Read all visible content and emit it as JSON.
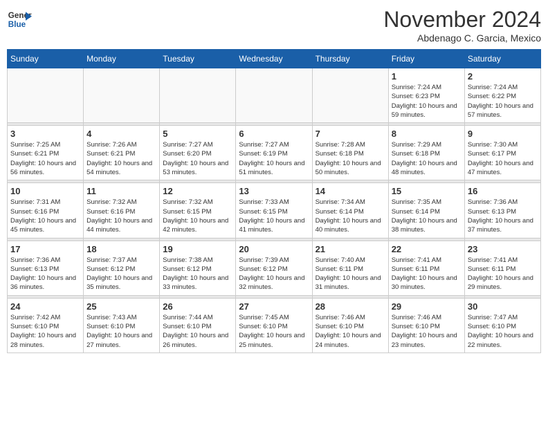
{
  "header": {
    "logo_line1": "General",
    "logo_line2": "Blue",
    "month": "November 2024",
    "location": "Abdenago C. Garcia, Mexico"
  },
  "days_of_week": [
    "Sunday",
    "Monday",
    "Tuesday",
    "Wednesday",
    "Thursday",
    "Friday",
    "Saturday"
  ],
  "weeks": [
    [
      {
        "day": "",
        "info": ""
      },
      {
        "day": "",
        "info": ""
      },
      {
        "day": "",
        "info": ""
      },
      {
        "day": "",
        "info": ""
      },
      {
        "day": "",
        "info": ""
      },
      {
        "day": "1",
        "info": "Sunrise: 7:24 AM\nSunset: 6:23 PM\nDaylight: 10 hours\nand 59 minutes."
      },
      {
        "day": "2",
        "info": "Sunrise: 7:24 AM\nSunset: 6:22 PM\nDaylight: 10 hours\nand 57 minutes."
      }
    ],
    [
      {
        "day": "3",
        "info": "Sunrise: 7:25 AM\nSunset: 6:21 PM\nDaylight: 10 hours\nand 56 minutes."
      },
      {
        "day": "4",
        "info": "Sunrise: 7:26 AM\nSunset: 6:21 PM\nDaylight: 10 hours\nand 54 minutes."
      },
      {
        "day": "5",
        "info": "Sunrise: 7:27 AM\nSunset: 6:20 PM\nDaylight: 10 hours\nand 53 minutes."
      },
      {
        "day": "6",
        "info": "Sunrise: 7:27 AM\nSunset: 6:19 PM\nDaylight: 10 hours\nand 51 minutes."
      },
      {
        "day": "7",
        "info": "Sunrise: 7:28 AM\nSunset: 6:18 PM\nDaylight: 10 hours\nand 50 minutes."
      },
      {
        "day": "8",
        "info": "Sunrise: 7:29 AM\nSunset: 6:18 PM\nDaylight: 10 hours\nand 48 minutes."
      },
      {
        "day": "9",
        "info": "Sunrise: 7:30 AM\nSunset: 6:17 PM\nDaylight: 10 hours\nand 47 minutes."
      }
    ],
    [
      {
        "day": "10",
        "info": "Sunrise: 7:31 AM\nSunset: 6:16 PM\nDaylight: 10 hours\nand 45 minutes."
      },
      {
        "day": "11",
        "info": "Sunrise: 7:32 AM\nSunset: 6:16 PM\nDaylight: 10 hours\nand 44 minutes."
      },
      {
        "day": "12",
        "info": "Sunrise: 7:32 AM\nSunset: 6:15 PM\nDaylight: 10 hours\nand 42 minutes."
      },
      {
        "day": "13",
        "info": "Sunrise: 7:33 AM\nSunset: 6:15 PM\nDaylight: 10 hours\nand 41 minutes."
      },
      {
        "day": "14",
        "info": "Sunrise: 7:34 AM\nSunset: 6:14 PM\nDaylight: 10 hours\nand 40 minutes."
      },
      {
        "day": "15",
        "info": "Sunrise: 7:35 AM\nSunset: 6:14 PM\nDaylight: 10 hours\nand 38 minutes."
      },
      {
        "day": "16",
        "info": "Sunrise: 7:36 AM\nSunset: 6:13 PM\nDaylight: 10 hours\nand 37 minutes."
      }
    ],
    [
      {
        "day": "17",
        "info": "Sunrise: 7:36 AM\nSunset: 6:13 PM\nDaylight: 10 hours\nand 36 minutes."
      },
      {
        "day": "18",
        "info": "Sunrise: 7:37 AM\nSunset: 6:12 PM\nDaylight: 10 hours\nand 35 minutes."
      },
      {
        "day": "19",
        "info": "Sunrise: 7:38 AM\nSunset: 6:12 PM\nDaylight: 10 hours\nand 33 minutes."
      },
      {
        "day": "20",
        "info": "Sunrise: 7:39 AM\nSunset: 6:12 PM\nDaylight: 10 hours\nand 32 minutes."
      },
      {
        "day": "21",
        "info": "Sunrise: 7:40 AM\nSunset: 6:11 PM\nDaylight: 10 hours\nand 31 minutes."
      },
      {
        "day": "22",
        "info": "Sunrise: 7:41 AM\nSunset: 6:11 PM\nDaylight: 10 hours\nand 30 minutes."
      },
      {
        "day": "23",
        "info": "Sunrise: 7:41 AM\nSunset: 6:11 PM\nDaylight: 10 hours\nand 29 minutes."
      }
    ],
    [
      {
        "day": "24",
        "info": "Sunrise: 7:42 AM\nSunset: 6:10 PM\nDaylight: 10 hours\nand 28 minutes."
      },
      {
        "day": "25",
        "info": "Sunrise: 7:43 AM\nSunset: 6:10 PM\nDaylight: 10 hours\nand 27 minutes."
      },
      {
        "day": "26",
        "info": "Sunrise: 7:44 AM\nSunset: 6:10 PM\nDaylight: 10 hours\nand 26 minutes."
      },
      {
        "day": "27",
        "info": "Sunrise: 7:45 AM\nSunset: 6:10 PM\nDaylight: 10 hours\nand 25 minutes."
      },
      {
        "day": "28",
        "info": "Sunrise: 7:46 AM\nSunset: 6:10 PM\nDaylight: 10 hours\nand 24 minutes."
      },
      {
        "day": "29",
        "info": "Sunrise: 7:46 AM\nSunset: 6:10 PM\nDaylight: 10 hours\nand 23 minutes."
      },
      {
        "day": "30",
        "info": "Sunrise: 7:47 AM\nSunset: 6:10 PM\nDaylight: 10 hours\nand 22 minutes."
      }
    ]
  ]
}
